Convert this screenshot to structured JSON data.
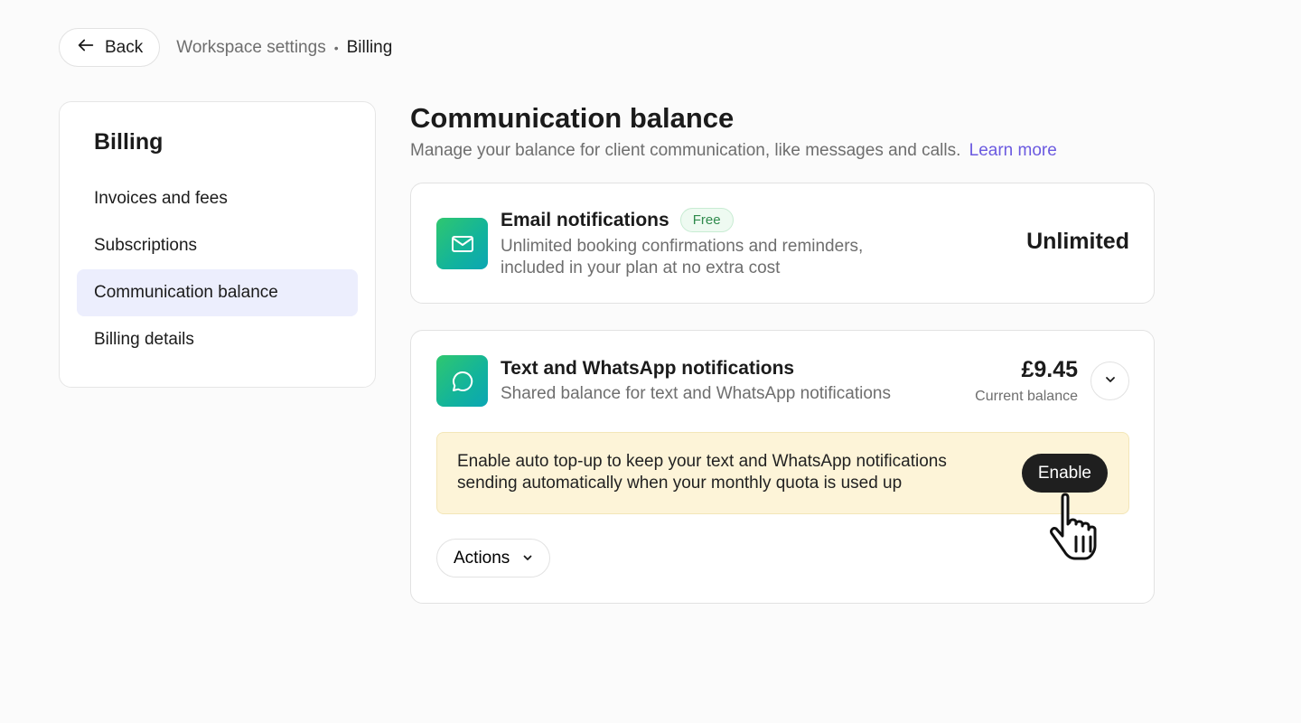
{
  "topbar": {
    "back_label": "Back",
    "breadcrumb": {
      "parent": "Workspace settings",
      "separator": "•",
      "current": "Billing"
    }
  },
  "sidebar": {
    "title": "Billing",
    "items": [
      {
        "label": "Invoices and fees"
      },
      {
        "label": "Subscriptions"
      },
      {
        "label": "Communication balance",
        "active": true
      },
      {
        "label": "Billing details"
      }
    ]
  },
  "main": {
    "title": "Communication balance",
    "subtitle": "Manage your balance for client communication, like messages and calls.",
    "learn_more": "Learn more",
    "email_card": {
      "icon": "mail-icon",
      "title": "Email notifications",
      "badge": "Free",
      "description": "Unlimited booking confirmations and reminders, included in your plan at no extra cost",
      "value": "Unlimited"
    },
    "text_card": {
      "icon": "chat-bubble-icon",
      "title": "Text and WhatsApp notifications",
      "description": "Shared balance for text and WhatsApp notifications",
      "balance_amount": "£9.45",
      "balance_label": "Current balance",
      "notice_text": "Enable auto top-up to keep your text and WhatsApp notifications sending automatically when your monthly quota is used up",
      "enable_label": "Enable",
      "actions_label": "Actions"
    }
  },
  "colors": {
    "accent_link": "#6b5ae0",
    "active_nav_bg": "#eceefd",
    "notice_bg": "#fdf4d8",
    "badge_text": "#2f8a4c",
    "icon_gradient_start": "#2fc76f",
    "icon_gradient_end": "#0ba6b4"
  }
}
